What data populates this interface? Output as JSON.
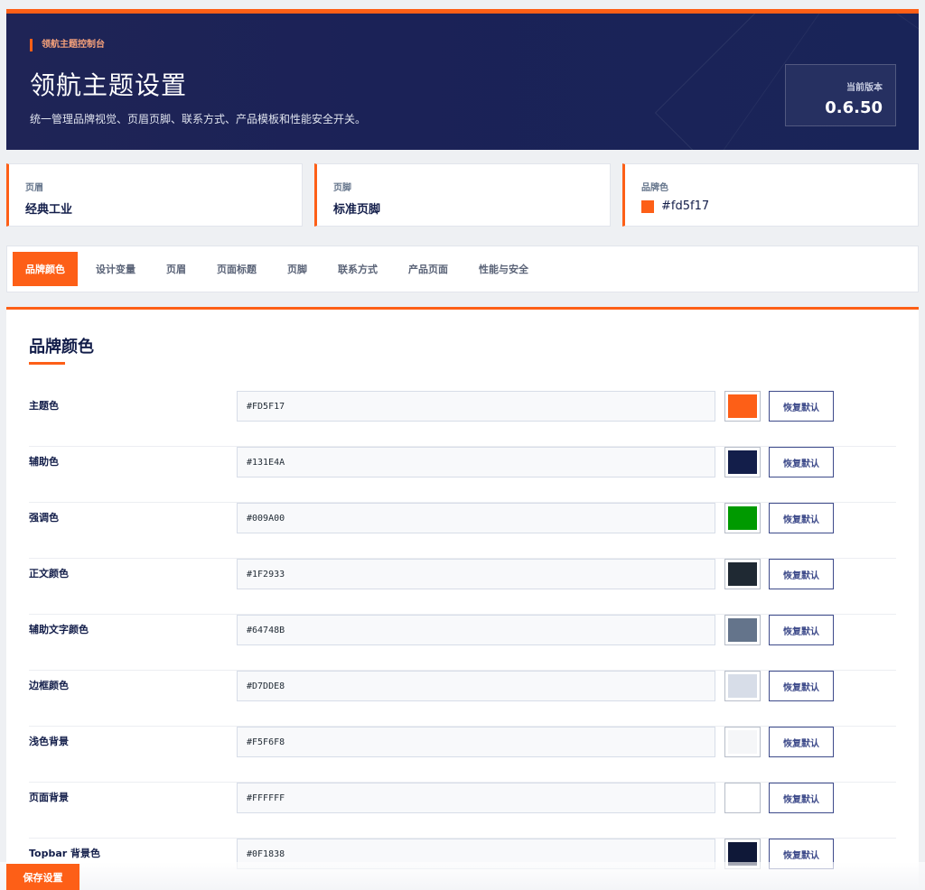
{
  "header": {
    "eyebrow": "领航主题控制台",
    "title": "领航主题设置",
    "description": "统一管理品牌视觉、页眉页脚、联系方式、产品模板和性能安全开关。",
    "version_label": "当前版本",
    "version_value": "0.6.50"
  },
  "summary_cards": [
    {
      "label": "页眉",
      "value": "经典工业"
    },
    {
      "label": "页脚",
      "value": "标准页脚"
    },
    {
      "label": "品牌色",
      "value": "#fd5f17",
      "color": "#fd5f17"
    }
  ],
  "tabs": [
    {
      "label": "品牌颜色",
      "active": true
    },
    {
      "label": "设计变量",
      "active": false
    },
    {
      "label": "页眉",
      "active": false
    },
    {
      "label": "页面标题",
      "active": false
    },
    {
      "label": "页脚",
      "active": false
    },
    {
      "label": "联系方式",
      "active": false
    },
    {
      "label": "产品页面",
      "active": false
    },
    {
      "label": "性能与安全",
      "active": false
    }
  ],
  "panel": {
    "title": "品牌颜色",
    "reset_label": "恢复默认",
    "rows": [
      {
        "label": "主题色",
        "value": "#FD5F17",
        "color": "#FD5F17"
      },
      {
        "label": "辅助色",
        "value": "#131E4A",
        "color": "#131E4A"
      },
      {
        "label": "强调色",
        "value": "#009A00",
        "color": "#009A00"
      },
      {
        "label": "正文颜色",
        "value": "#1F2933",
        "color": "#1F2933"
      },
      {
        "label": "辅助文字颜色",
        "value": "#64748B",
        "color": "#64748B"
      },
      {
        "label": "边框颜色",
        "value": "#D7DDE8",
        "color": "#D7DDE8"
      },
      {
        "label": "浅色背景",
        "value": "#F5F6F8",
        "color": "#F5F6F8"
      },
      {
        "label": "页面背景",
        "value": "#FFFFFF",
        "color": "#FFFFFF"
      },
      {
        "label": "Topbar 背景色",
        "value": "#0F1838",
        "color": "#0F1838"
      }
    ]
  },
  "footer": {
    "save_label": "保存设置"
  }
}
